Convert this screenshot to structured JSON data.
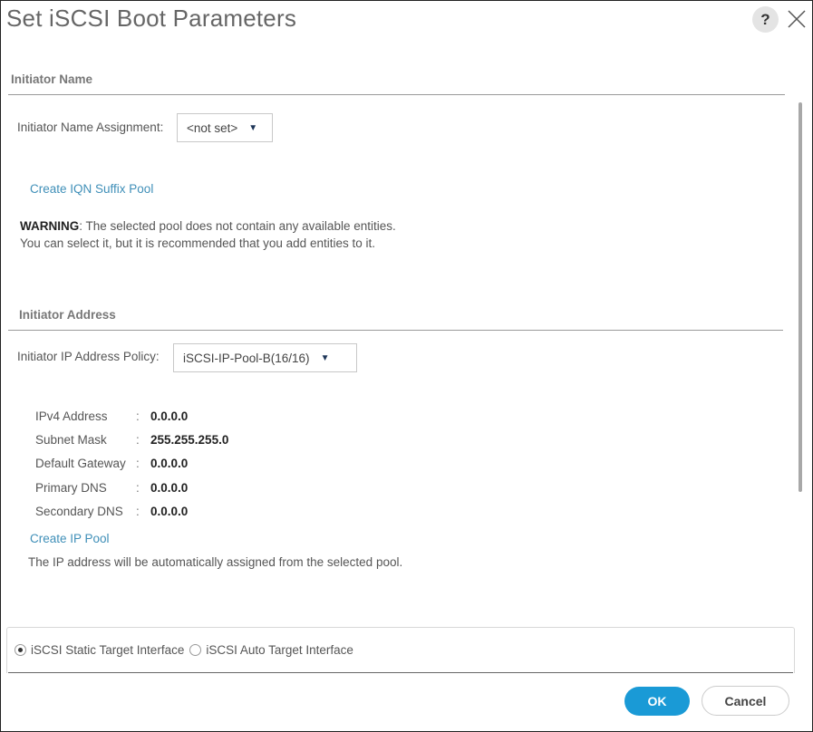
{
  "dialog": {
    "title": "Set iSCSI Boot Parameters",
    "help_label": "?",
    "close_icon": "close-icon"
  },
  "initiator_name": {
    "section_title": "Initiator Name",
    "assignment_label": "Initiator Name Assignment:",
    "assignment_value": "<not set>",
    "create_pool_link": "Create IQN Suffix Pool",
    "warning_label": "WARNING",
    "warning_line1": ": The selected pool does not contain any available entities.",
    "warning_line2": "You can select it, but it is recommended that you add entities to it."
  },
  "initiator_address": {
    "section_title": "Initiator Address",
    "policy_label": "Initiator IP Address Policy:",
    "policy_value": "iSCSI-IP-Pool-B(16/16)",
    "fields": [
      {
        "label": "IPv4 Address",
        "value": "0.0.0.0"
      },
      {
        "label": "Subnet Mask",
        "value": "255.255.255.0"
      },
      {
        "label": "Default Gateway",
        "value": "0.0.0.0"
      },
      {
        "label": "Primary DNS",
        "value": "0.0.0.0"
      },
      {
        "label": "Secondary DNS",
        "value": "0.0.0.0"
      }
    ],
    "separator": ":",
    "create_ip_pool_link": "Create IP Pool",
    "note": "The IP address will be automatically assigned from the selected pool."
  },
  "target_interface": {
    "options": [
      {
        "label": "iSCSI Static Target Interface",
        "selected": true
      },
      {
        "label": "iSCSI Auto Target Interface",
        "selected": false
      }
    ]
  },
  "footer": {
    "ok_label": "OK",
    "cancel_label": "Cancel"
  },
  "colors": {
    "primary_button": "#1a9ad6",
    "link": "#3f8fb8"
  }
}
